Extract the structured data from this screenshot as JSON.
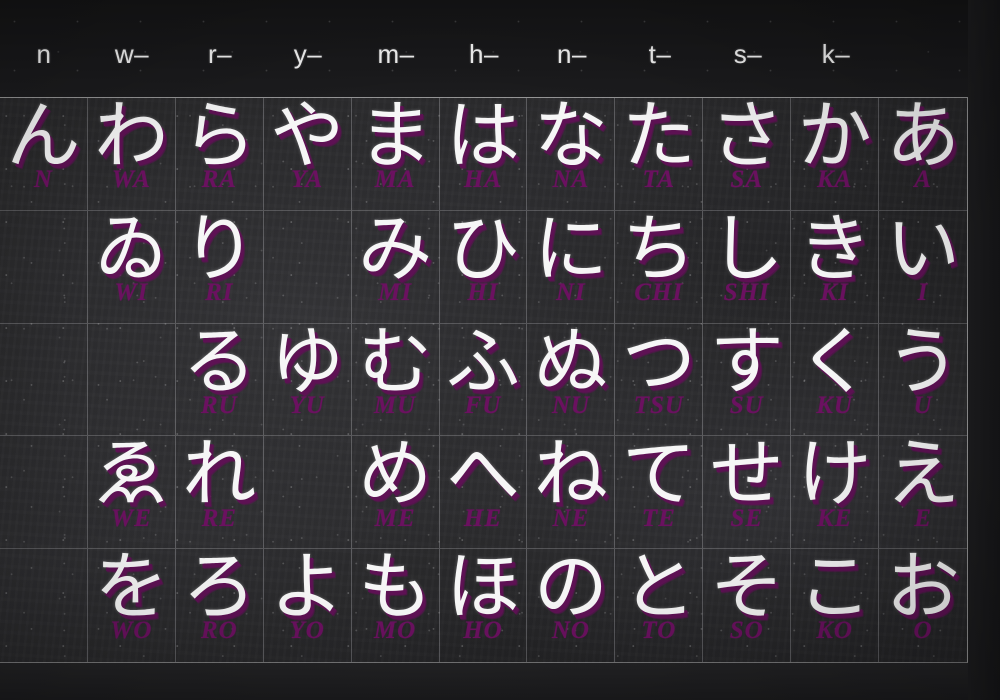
{
  "board": {
    "background_color": "#262628",
    "header_strip_color": "#16161a",
    "chalk_color": "#f6f6f6",
    "romaji_color": "#6b1160",
    "grid_line_color": "#c8c8cd"
  },
  "header": {
    "columns": [
      {
        "label": "n"
      },
      {
        "label": "w–"
      },
      {
        "label": "r–"
      },
      {
        "label": "y–"
      },
      {
        "label": "m–"
      },
      {
        "label": "h–"
      },
      {
        "label": "n–"
      },
      {
        "label": "t–"
      },
      {
        "label": "s–"
      },
      {
        "label": "k–"
      },
      {
        "label": ""
      }
    ]
  },
  "grid": {
    "columns": 11,
    "rows": 5,
    "cells": [
      [
        {
          "kana": "ん",
          "romaji": "N"
        },
        {
          "kana": "わ",
          "romaji": "WA"
        },
        {
          "kana": "ら",
          "romaji": "RA"
        },
        {
          "kana": "や",
          "romaji": "YA"
        },
        {
          "kana": "ま",
          "romaji": "MA"
        },
        {
          "kana": "は",
          "romaji": "HA"
        },
        {
          "kana": "な",
          "romaji": "NA"
        },
        {
          "kana": "た",
          "romaji": "TA"
        },
        {
          "kana": "さ",
          "romaji": "SA"
        },
        {
          "kana": "か",
          "romaji": "KA"
        },
        {
          "kana": "あ",
          "romaji": "A"
        }
      ],
      [
        {
          "kana": "",
          "romaji": ""
        },
        {
          "kana": "ゐ",
          "romaji": "WI"
        },
        {
          "kana": "り",
          "romaji": "RI"
        },
        {
          "kana": "",
          "romaji": ""
        },
        {
          "kana": "み",
          "romaji": "MI"
        },
        {
          "kana": "ひ",
          "romaji": "HI"
        },
        {
          "kana": "に",
          "romaji": "NI"
        },
        {
          "kana": "ち",
          "romaji": "CHI"
        },
        {
          "kana": "し",
          "romaji": "SHI"
        },
        {
          "kana": "き",
          "romaji": "KI"
        },
        {
          "kana": "い",
          "romaji": "I"
        }
      ],
      [
        {
          "kana": "",
          "romaji": ""
        },
        {
          "kana": "",
          "romaji": ""
        },
        {
          "kana": "る",
          "romaji": "RU"
        },
        {
          "kana": "ゆ",
          "romaji": "YU"
        },
        {
          "kana": "む",
          "romaji": "MU"
        },
        {
          "kana": "ふ",
          "romaji": "FU"
        },
        {
          "kana": "ぬ",
          "romaji": "NU"
        },
        {
          "kana": "つ",
          "romaji": "TSU"
        },
        {
          "kana": "す",
          "romaji": "SU"
        },
        {
          "kana": "く",
          "romaji": "KU"
        },
        {
          "kana": "う",
          "romaji": "U"
        }
      ],
      [
        {
          "kana": "",
          "romaji": ""
        },
        {
          "kana": "ゑ",
          "romaji": "WE"
        },
        {
          "kana": "れ",
          "romaji": "RE"
        },
        {
          "kana": "",
          "romaji": ""
        },
        {
          "kana": "め",
          "romaji": "ME"
        },
        {
          "kana": "へ",
          "romaji": "HE"
        },
        {
          "kana": "ね",
          "romaji": "NE"
        },
        {
          "kana": "て",
          "romaji": "TE"
        },
        {
          "kana": "せ",
          "romaji": "SE"
        },
        {
          "kana": "け",
          "romaji": "KE"
        },
        {
          "kana": "え",
          "romaji": "E"
        }
      ],
      [
        {
          "kana": "",
          "romaji": ""
        },
        {
          "kana": "を",
          "romaji": "WO"
        },
        {
          "kana": "ろ",
          "romaji": "RO"
        },
        {
          "kana": "よ",
          "romaji": "YO"
        },
        {
          "kana": "も",
          "romaji": "MO"
        },
        {
          "kana": "ほ",
          "romaji": "HO"
        },
        {
          "kana": "の",
          "romaji": "NO"
        },
        {
          "kana": "と",
          "romaji": "TO"
        },
        {
          "kana": "そ",
          "romaji": "SO"
        },
        {
          "kana": "こ",
          "romaji": "KO"
        },
        {
          "kana": "お",
          "romaji": "O"
        }
      ]
    ]
  }
}
